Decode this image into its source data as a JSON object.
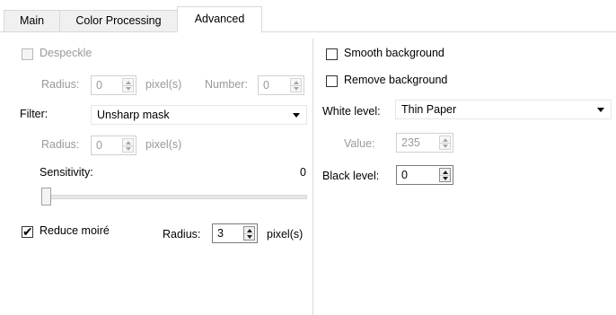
{
  "tabs": [
    {
      "label": "Main",
      "active": false
    },
    {
      "label": "Color Processing",
      "active": false
    },
    {
      "label": "Advanced",
      "active": true
    }
  ],
  "left": {
    "despeckle": {
      "label": "Despeckle",
      "checked": false,
      "enabled": false
    },
    "despeckle_radius": {
      "label": "Radius:",
      "value": "0",
      "unit": "pixel(s)"
    },
    "despeckle_number": {
      "label": "Number:",
      "value": "0"
    },
    "filter": {
      "label": "Filter:",
      "value": "Unsharp mask"
    },
    "filter_radius": {
      "label": "Radius:",
      "value": "0",
      "unit": "pixel(s)"
    },
    "sensitivity": {
      "label": "Sensitivity:",
      "value": "0"
    },
    "reduce_moire": {
      "label": "Reduce moiré",
      "checked": true
    },
    "moire_radius": {
      "label": "Radius:",
      "value": "3",
      "unit": "pixel(s)"
    }
  },
  "right": {
    "smooth_background": {
      "label": "Smooth background",
      "checked": false
    },
    "remove_background": {
      "label": "Remove background",
      "checked": false
    },
    "white_level": {
      "label": "White level:",
      "value": "Thin Paper"
    },
    "value": {
      "label": "Value:",
      "value": "235"
    },
    "black_level": {
      "label": "Black level:",
      "value": "0"
    }
  },
  "icons": {
    "check": "✔",
    "spin_up": "triangle-up",
    "spin_down": "triangle-down",
    "dropdown": "triangle-down"
  }
}
